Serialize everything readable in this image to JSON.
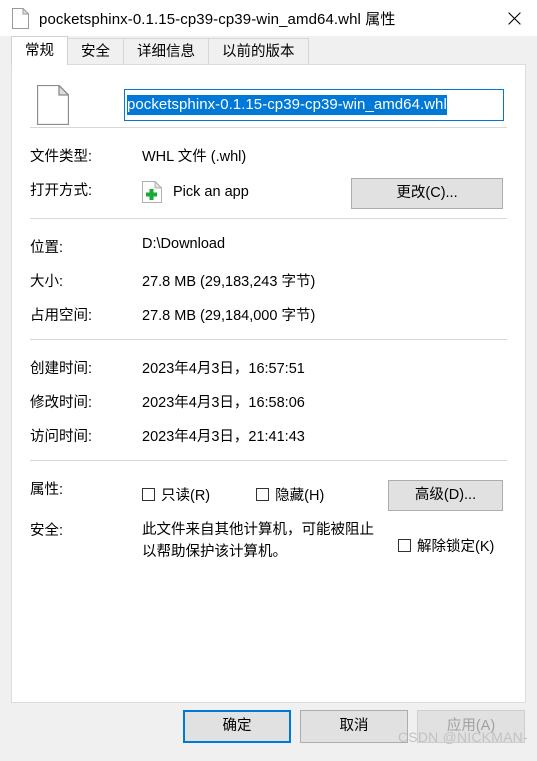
{
  "window": {
    "title": "pocketsphinx-0.1.15-cp39-cp39-win_amd64.whl 属性",
    "icon": "file-icon",
    "close_label": "✕"
  },
  "tabs": [
    {
      "label": "常规",
      "active": true
    },
    {
      "label": "安全",
      "active": false
    },
    {
      "label": "详细信息",
      "active": false
    },
    {
      "label": "以前的版本",
      "active": false
    }
  ],
  "general": {
    "filename": "pocketsphinx-0.1.15-cp39-cp39-win_amd64.whl",
    "file_type_label": "文件类型:",
    "file_type_value": "WHL 文件 (.whl)",
    "open_with_label": "打开方式:",
    "open_with_value": "Pick an app",
    "open_with_icon": "pick-an-app-icon",
    "change_button": "更改(C)...",
    "location_label": "位置:",
    "location_value": "D:\\Download",
    "size_label": "大小:",
    "size_value": "27.8 MB (29,183,243 字节)",
    "size_on_disk_label": "占用空间:",
    "size_on_disk_value": "27.8 MB (29,184,000 字节)",
    "created_label": "创建时间:",
    "created_value": "2023年4月3日，16:57:51",
    "modified_label": "修改时间:",
    "modified_value": "2023年4月3日，16:58:06",
    "accessed_label": "访问时间:",
    "accessed_value": "2023年4月3日，21:41:43",
    "attributes_label": "属性:",
    "readonly_label": "只读(R)",
    "readonly_checked": false,
    "hidden_label": "隐藏(H)",
    "hidden_checked": false,
    "advanced_button": "高级(D)...",
    "security_label": "安全:",
    "security_text_line1": "此文件来自其他计算机，可能被阻止",
    "security_text_line2": "以帮助保护该计算机。",
    "unblock_label": "解除锁定(K)",
    "unblock_checked": false
  },
  "footer": {
    "ok": "确定",
    "cancel": "取消",
    "apply": "应用(A)"
  },
  "watermark": "CSDN @NICKMAN-",
  "colors": {
    "accent": "#0078d7",
    "dialog_bg": "#f0f0f0",
    "panel_bg": "#ffffff",
    "button_bg": "#e1e1e1",
    "disabled_text": "#a0a0a0"
  }
}
